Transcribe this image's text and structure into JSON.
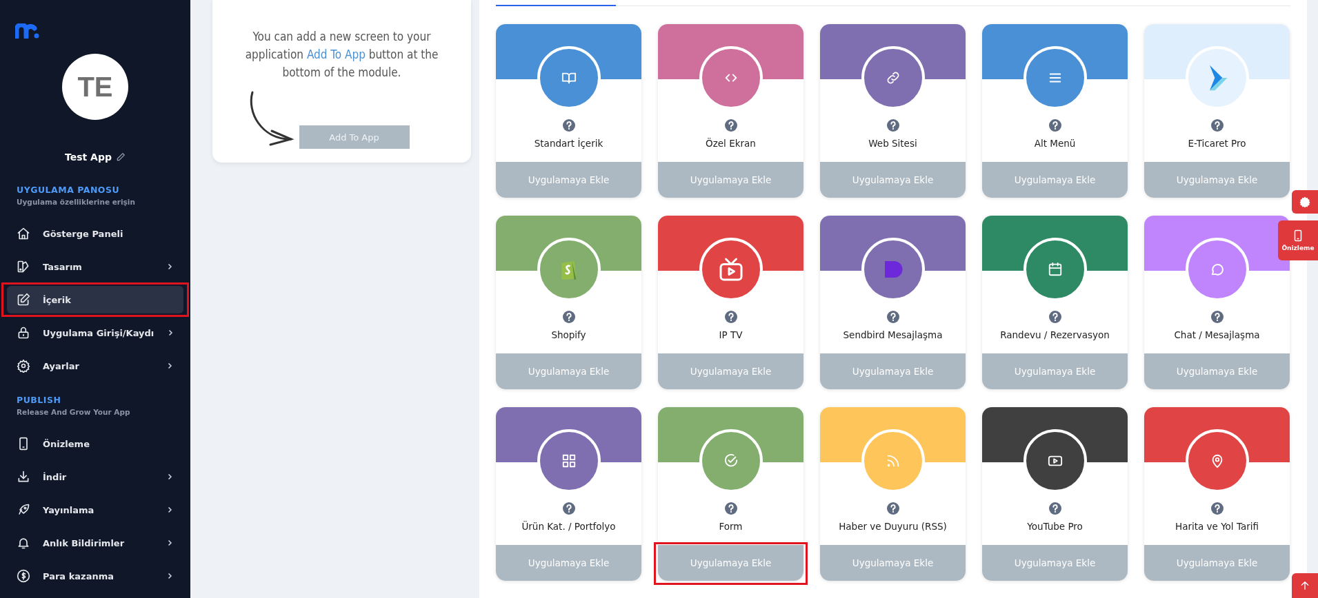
{
  "sidebar": {
    "avatar_initials": "TE",
    "app_name": "Test App",
    "sections": [
      {
        "title": "UYGULAMA PANOSU",
        "subtitle": "Uygulama özelliklerine erişin",
        "items": [
          {
            "label": "Gösterge Paneli",
            "has_submenu": false,
            "selected": false,
            "highlighted": false
          },
          {
            "label": "Tasarım",
            "has_submenu": true,
            "selected": false,
            "highlighted": false
          },
          {
            "label": "İçerik",
            "has_submenu": false,
            "selected": true,
            "highlighted": true
          },
          {
            "label": "Uygulama Girişi/Kaydı",
            "has_submenu": true,
            "selected": false,
            "highlighted": false
          },
          {
            "label": "Ayarlar",
            "has_submenu": true,
            "selected": false,
            "highlighted": false
          }
        ]
      },
      {
        "title": "PUBLISH",
        "subtitle": "Release And Grow Your App",
        "items": [
          {
            "label": "Önizleme",
            "has_submenu": false,
            "selected": false,
            "highlighted": false
          },
          {
            "label": "İndir",
            "has_submenu": true,
            "selected": false,
            "highlighted": false
          },
          {
            "label": "Yayınlama",
            "has_submenu": true,
            "selected": false,
            "highlighted": false
          },
          {
            "label": "Anlık Bildirimler",
            "has_submenu": true,
            "selected": false,
            "highlighted": false
          },
          {
            "label": "Para kazanma",
            "has_submenu": true,
            "selected": false,
            "highlighted": false
          }
        ]
      }
    ]
  },
  "info_card": {
    "text_before": "You can add a new screen to your application",
    "link": "Add To App",
    "text_after": "button at the bottom of the module.",
    "button": "Add To App"
  },
  "modules": [
    {
      "title": "Standart İçerik",
      "color": "#4a90d6",
      "button": "Uygulamaya Ekle",
      "highlighted": false
    },
    {
      "title": "Özel Ekran",
      "color": "#cf6f9b",
      "button": "Uygulamaya Ekle",
      "highlighted": false
    },
    {
      "title": "Web Sitesi",
      "color": "#7f6fb0",
      "button": "Uygulamaya Ekle",
      "highlighted": false
    },
    {
      "title": "Alt Menü",
      "color": "#4a90d6",
      "button": "Uygulamaya Ekle",
      "highlighted": false
    },
    {
      "title": "E-Ticaret Pro",
      "color": "#dfeefc",
      "button": "Uygulamaya Ekle",
      "highlighted": false
    },
    {
      "title": "Shopify",
      "color": "#84ae6e",
      "button": "Uygulamaya Ekle",
      "highlighted": false
    },
    {
      "title": "IP TV",
      "color": "#e04444",
      "button": "Uygulamaya Ekle",
      "highlighted": false
    },
    {
      "title": "Sendbird Mesajlaşma",
      "color": "#7f6fb0",
      "button": "Uygulamaya Ekle",
      "highlighted": false
    },
    {
      "title": "Randevu / Rezervasyon",
      "color": "#2e8a64",
      "button": "Uygulamaya Ekle",
      "highlighted": false
    },
    {
      "title": "Chat / Mesajlaşma",
      "color": "#c084fc",
      "button": "Uygulamaya Ekle",
      "highlighted": false
    },
    {
      "title": "Ürün Kat. / Portfolyo",
      "color": "#7f6fb0",
      "button": "Uygulamaya Ekle",
      "highlighted": false
    },
    {
      "title": "Form",
      "color": "#84ae6e",
      "button": "Uygulamaya Ekle",
      "highlighted": true
    },
    {
      "title": "Haber ve Duyuru (RSS)",
      "color": "#fec55a",
      "button": "Uygulamaya Ekle",
      "highlighted": false
    },
    {
      "title": "YouTube Pro",
      "color": "#404040",
      "button": "Uygulamaya Ekle",
      "highlighted": false
    },
    {
      "title": "Harita ve Yol Tarifi",
      "color": "#e04444",
      "button": "Uygulamaya Ekle",
      "highlighted": false
    }
  ],
  "floating": {
    "preview_label": "Önizleme"
  }
}
